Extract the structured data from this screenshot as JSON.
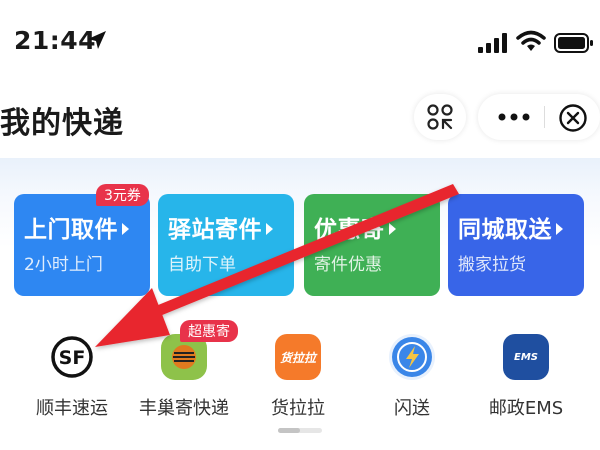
{
  "status_bar": {
    "time": "21:44"
  },
  "header": {
    "title": "我的快递"
  },
  "tiles": [
    {
      "title": "上门取件",
      "subtitle": "2小时上门",
      "color": "#2e87f2"
    },
    {
      "title": "驿站寄件",
      "subtitle": "自助下单",
      "color": "#27b5ea"
    },
    {
      "title": "优惠寄",
      "subtitle": "寄件优惠",
      "color": "#3fb055"
    },
    {
      "title": "同城取送",
      "subtitle": "搬家拉货",
      "color": "#3865e8"
    }
  ],
  "badges": {
    "pickup": "3元券",
    "fengchao": "超惠寄"
  },
  "services": [
    {
      "label": "顺丰速运",
      "icon": "sf-express-icon"
    },
    {
      "label": "丰巢寄快递",
      "icon": "fengchao-icon",
      "icon_text": ""
    },
    {
      "label": "货拉拉",
      "icon": "huolala-icon",
      "icon_text": "货拉拉"
    },
    {
      "label": "闪送",
      "icon": "shansong-icon"
    },
    {
      "label": "邮政EMS",
      "icon": "ems-icon",
      "icon_text": "EMS"
    }
  ],
  "colors": {
    "annotation_arrow": "#e8262e",
    "badge": "#e8334a"
  }
}
